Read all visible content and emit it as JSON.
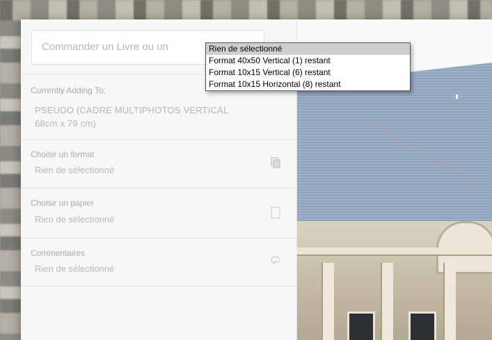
{
  "search": {
    "placeholder": "Commander un Livre ou un"
  },
  "currently_adding": {
    "label": "Currently Adding To:",
    "value_line1": "PSEUDO (CADRE MULTIPHOTOS VERTICAL",
    "value_line2": "68cm x 79 cm)"
  },
  "sections": [
    {
      "title": "Choisir un format",
      "value": "Rien de sélectionné",
      "icon": "copy-icon"
    },
    {
      "title": "Choisir un papier",
      "value": "Rien de sélectionné",
      "icon": "page-icon"
    },
    {
      "title": "Commentaires",
      "value": "Rien de sélectionné",
      "icon": "speech-bubble-icon"
    }
  ],
  "dropdown": {
    "options": [
      "Rien de sélectionné",
      "Format 40x50 Vertical (1) restant",
      "Format 10x15 Vertical (6) restant",
      "Format 10x15 Horizontal (8) restant"
    ],
    "selected_index": 0
  }
}
